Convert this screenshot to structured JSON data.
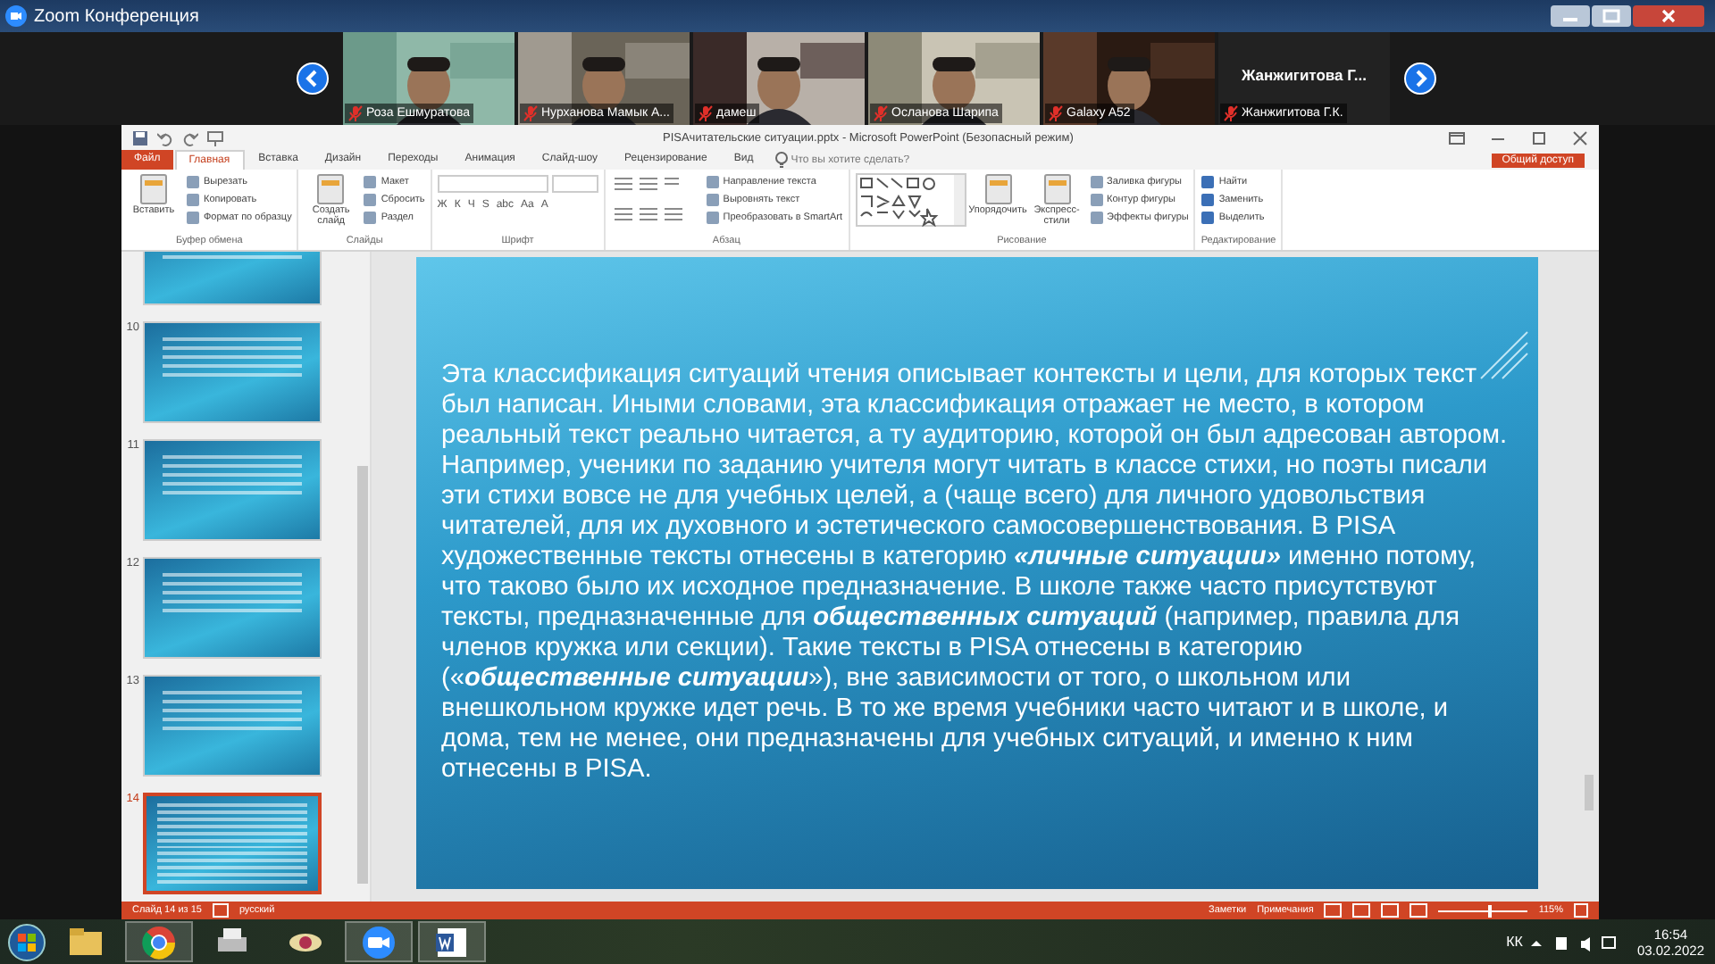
{
  "zoom": {
    "title": "Zoom Конференция",
    "participants": [
      {
        "name": "Роза Ешмуратова",
        "kind": "video"
      },
      {
        "name": "Нурханова Мамык А...",
        "kind": "video"
      },
      {
        "name": "дамеш",
        "kind": "video"
      },
      {
        "name": "Осланова Шарипа",
        "kind": "video"
      },
      {
        "name": "Galaxy A52",
        "kind": "video"
      },
      {
        "name": "Жанжигитова Г.К.",
        "kind": "name_only",
        "display_name": "Жанжигитова  Г..."
      }
    ]
  },
  "powerpoint": {
    "title": "PISAчитательские ситуации.pptx - Microsoft PowerPoint (Безопасный режим)",
    "tabs": [
      {
        "label": "Файл",
        "kind": "file",
        "selected": false
      },
      {
        "label": "Главная",
        "kind": "tab",
        "selected": true
      },
      {
        "label": "Вставка",
        "kind": "tab",
        "selected": false
      },
      {
        "label": "Дизайн",
        "kind": "tab",
        "selected": false
      },
      {
        "label": "Переходы",
        "kind": "tab",
        "selected": false
      },
      {
        "label": "Анимация",
        "kind": "tab",
        "selected": false
      },
      {
        "label": "Слайд-шоу",
        "kind": "tab",
        "selected": false
      },
      {
        "label": "Рецензирование",
        "kind": "tab",
        "selected": false
      },
      {
        "label": "Вид",
        "kind": "tab",
        "selected": false
      }
    ],
    "search": {
      "placeholder": "Что вы хотите сделать?"
    },
    "share": "Общий доступ",
    "groups": [
      {
        "label": "Буфер обмена",
        "items": [
          {
            "kind": "large",
            "label": "Вставить"
          },
          {
            "kind": "small",
            "label": "Вырезать"
          },
          {
            "kind": "small",
            "label": "Копировать"
          },
          {
            "kind": "small",
            "label": "Формат по образцу"
          }
        ]
      },
      {
        "label": "Слайды",
        "items": [
          {
            "kind": "large",
            "label": "Создать слайд"
          },
          {
            "kind": "small",
            "label": "Макет"
          },
          {
            "kind": "small",
            "label": "Сбросить"
          },
          {
            "kind": "small",
            "label": "Раздел"
          }
        ]
      },
      {
        "label": "Шрифт",
        "items": [
          {
            "kind": "font"
          },
          {
            "kind": "glyph",
            "label": "Ж"
          },
          {
            "kind": "glyph",
            "label": "К"
          },
          {
            "kind": "glyph",
            "label": "Ч"
          },
          {
            "kind": "glyph",
            "label": "S"
          },
          {
            "kind": "glyph",
            "label": "abc"
          },
          {
            "kind": "glyph",
            "label": "Aa"
          },
          {
            "kind": "glyph",
            "label": "A"
          }
        ]
      },
      {
        "label": "Абзац",
        "items": [
          {
            "kind": "align"
          },
          {
            "kind": "small",
            "label": "Направление текста"
          },
          {
            "kind": "small",
            "label": "Выровнять текст"
          },
          {
            "kind": "small",
            "label": "Преобразовать в SmartArt"
          }
        ]
      },
      {
        "label": "Рисование",
        "items": [
          {
            "kind": "shapes"
          },
          {
            "kind": "large",
            "label": "Упорядочить"
          },
          {
            "kind": "large",
            "label": "Экспресс-стили"
          },
          {
            "kind": "small",
            "label": "Заливка фигуры"
          },
          {
            "kind": "small",
            "label": "Контур фигуры"
          },
          {
            "kind": "small",
            "label": "Эффекты фигуры"
          }
        ]
      },
      {
        "label": "Редактирование",
        "items": [
          {
            "kind": "small",
            "label": "Найти"
          },
          {
            "kind": "small",
            "label": "Заменить"
          },
          {
            "kind": "small",
            "label": "Выделить"
          }
        ]
      }
    ],
    "thumbnails": [
      {
        "selected": false
      },
      {
        "number": "10",
        "selected": false
      },
      {
        "number": "11",
        "selected": false
      },
      {
        "number": "12",
        "selected": false
      },
      {
        "number": "13",
        "selected": false
      },
      {
        "number": "14",
        "selected": true
      }
    ],
    "slide": {
      "text": "Эта классификация ситуаций чтения описывает контексты и цели, для которых текст был написан. Иными словами, эта классификация отражает не место, в котором реальный текст реально читается, а ту аудиторию, которой он был адресован автором. Например, ученики по заданию учителя могут читать в классе стихи, но поэты писали эти стихи вовсе не для учебных целей, а (чаще всего) для личного удовольствия читателей, для их духовного и эстетического самосовершенствования. В PISA художественные тексты отнесены в категорию **«личные ситуации»** именно потому, что таково было их исходное предназначение. В школе также часто присутствуют тексты, предназначенные для **общественных ситуаций** (например, правила для членов кружка или секции). Такие тексты в PISA отнесены в категорию («**общественные ситуации**»), вне зависимости от того, о школьном или внешкольном кружке идет речь. В то же время учебники часто читают и в школе, и дома, тем не менее, они предназначены для учебных ситуаций, и именно к ним отнесены в PISA."
    },
    "status": {
      "slide": "Слайд 14 из 15",
      "language": "русский",
      "notes": "Заметки",
      "comments": "Примечания",
      "zoom": "115%",
      "level": 0.55
    }
  },
  "taskbar": {
    "language": "КК",
    "time": "16:54",
    "date": "03.02.2022"
  }
}
